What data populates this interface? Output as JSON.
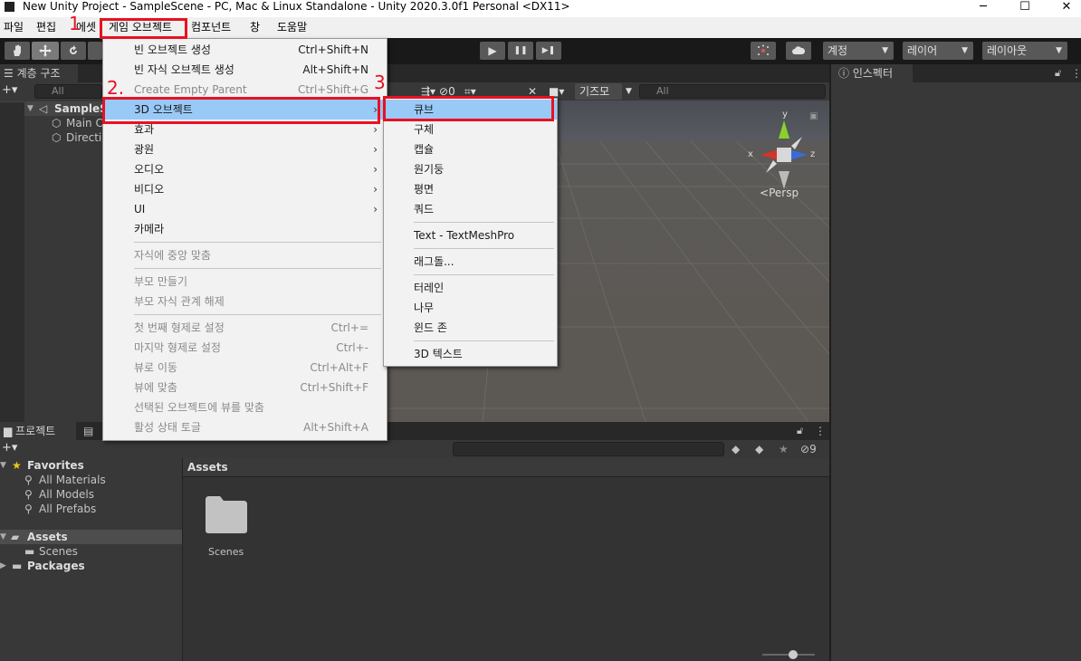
{
  "window": {
    "title": "New Unity Project - SampleScene - PC, Mac & Linux Standalone - Unity 2020.3.0f1 Personal <DX11>",
    "min_glyph": "─",
    "max_glyph": "☐",
    "close_glyph": "✕"
  },
  "menubar": [
    "파일",
    "편집",
    "에셋",
    "게임 오브젝트",
    "컴포넌트",
    "창",
    "도움말"
  ],
  "toolbar": {
    "play": "▶",
    "pause": "❚❚",
    "step": "▶❚",
    "account": "계정",
    "layers": "레이어",
    "layout": "레이아웃"
  },
  "hierarchy": {
    "tab": "계층 구조",
    "add": "+▾",
    "search_placeholder": "All",
    "scene": "SampleS",
    "items": [
      "Main C",
      "Directio"
    ]
  },
  "scene_view": {
    "gizmos": "기즈모",
    "search_placeholder": "All",
    "hidden_count": "0",
    "persp": "Persp",
    "axis_x": "x",
    "axis_y": "y",
    "axis_z": "z"
  },
  "inspector": {
    "tab": "인스펙터"
  },
  "project": {
    "tab": "프로젝트",
    "add": "+▾",
    "hidden_count": "9",
    "favorites": "Favorites",
    "fav_items": [
      "All Materials",
      "All Models",
      "All Prefabs"
    ],
    "assets": "Assets",
    "asset_items": [
      "Scenes"
    ],
    "packages": "Packages",
    "breadcrumb": "Assets",
    "folder_name": "Scenes"
  },
  "context_menu": {
    "items": [
      {
        "label": "빈 오브젝트 생성",
        "shortcut": "Ctrl+Shift+N",
        "arrow": "",
        "disabled": false
      },
      {
        "label": "빈 자식 오브젝트 생성",
        "shortcut": "Alt+Shift+N",
        "arrow": "",
        "disabled": false
      },
      {
        "label": "Create Empty Parent",
        "shortcut": "Ctrl+Shift+G",
        "arrow": "",
        "disabled": true
      },
      {
        "label": "3D 오브젝트",
        "shortcut": "",
        "arrow": "›",
        "disabled": false
      },
      {
        "label": "효과",
        "shortcut": "",
        "arrow": "›",
        "disabled": false
      },
      {
        "label": "광원",
        "shortcut": "",
        "arrow": "›",
        "disabled": false
      },
      {
        "label": "오디오",
        "shortcut": "",
        "arrow": "›",
        "disabled": false
      },
      {
        "label": "비디오",
        "shortcut": "",
        "arrow": "›",
        "disabled": false
      },
      {
        "label": "UI",
        "shortcut": "",
        "arrow": "›",
        "disabled": false
      },
      {
        "label": "카메라",
        "shortcut": "",
        "arrow": "",
        "disabled": false
      },
      {
        "label": "자식에 중앙 맞춤",
        "shortcut": "",
        "arrow": "",
        "disabled": true
      },
      {
        "label": "부모 만들기",
        "shortcut": "",
        "arrow": "",
        "disabled": true
      },
      {
        "label": "부모 자식 관계 해제",
        "shortcut": "",
        "arrow": "",
        "disabled": true
      },
      {
        "label": "첫 번째 형제로 설정",
        "shortcut": "Ctrl+=",
        "arrow": "",
        "disabled": true
      },
      {
        "label": "마지막 형제로 설정",
        "shortcut": "Ctrl+-",
        "arrow": "",
        "disabled": true
      },
      {
        "label": "뷰로 이동",
        "shortcut": "Ctrl+Alt+F",
        "arrow": "",
        "disabled": true
      },
      {
        "label": "뷰에 맞춤",
        "shortcut": "Ctrl+Shift+F",
        "arrow": "",
        "disabled": true
      },
      {
        "label": "선택된 오브젝트에 뷰를 맞춤",
        "shortcut": "",
        "arrow": "",
        "disabled": true
      },
      {
        "label": "활성 상태 토글",
        "shortcut": "Alt+Shift+A",
        "arrow": "",
        "disabled": true
      }
    ]
  },
  "submenu_3d": {
    "items": [
      "큐브",
      "구체",
      "캡슐",
      "원기둥",
      "평면",
      "쿼드",
      "Text - TextMeshPro",
      "래그돌...",
      "터레인",
      "나무",
      "윈드 존",
      "3D 텍스트"
    ]
  },
  "annotations": {
    "step1": "1",
    "step2": "2.",
    "step3": "3"
  },
  "colors": {
    "highlight": "#99c9f7",
    "annotation_red": "#e81123",
    "gizmo_y": "#8ad12b",
    "gizmo_x": "#d3352a",
    "gizmo_z": "#3b6bd6"
  }
}
